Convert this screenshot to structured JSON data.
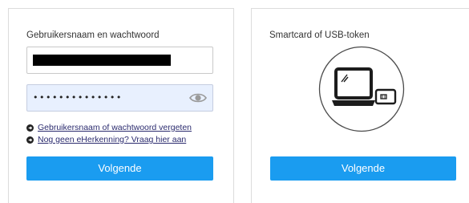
{
  "password_login": {
    "title": "Gebruikersnaam en wachtwoord",
    "password_value": "••••••••••••••",
    "links": [
      {
        "label": "Gebruikersnaam of wachtwoord vergeten"
      },
      {
        "label": "Nog geen eHerkenning? Vraag hier aan"
      }
    ],
    "submit_label": "Volgende"
  },
  "smartcard_login": {
    "title": "Smartcard of USB-token",
    "submit_label": "Volgende"
  },
  "icons": {
    "password_toggle": "eye-icon",
    "link_bullet": "arrow-circle-right-icon",
    "device": "laptop-with-smartcard-icon"
  },
  "colors": {
    "button": "#1a9cf0",
    "link": "#2b2b6e",
    "autofill_bg": "#e8f0fe",
    "border": "#dcdcdc"
  }
}
